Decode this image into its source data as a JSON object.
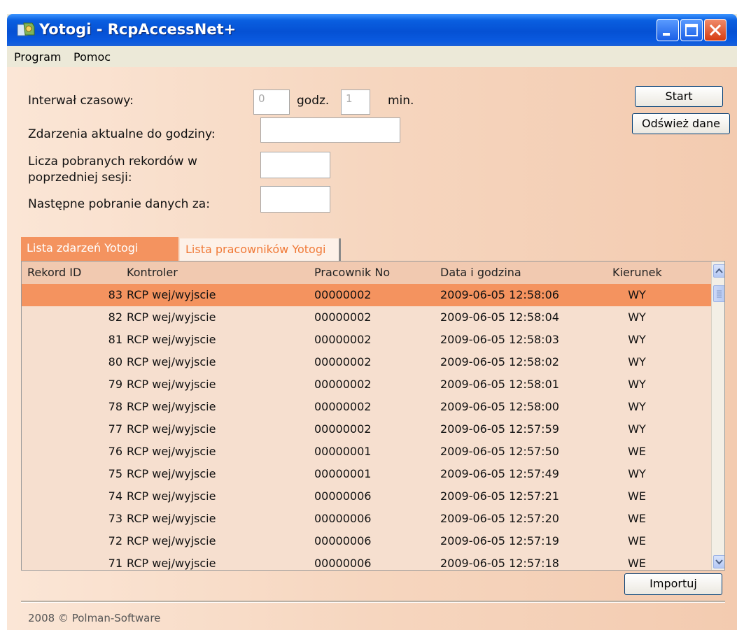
{
  "window": {
    "title": "Yotogi - RcpAccessNet+"
  },
  "menu": {
    "items": [
      {
        "label": "Program"
      },
      {
        "label": "Pomoc"
      }
    ]
  },
  "form": {
    "interval_label": "Interwał czasowy:",
    "interval_hours": "0",
    "hours_unit": "godz.",
    "interval_minutes": "1",
    "minutes_unit": "min.",
    "events_label": "Zdarzenia aktualne do godziny:",
    "records_label_line1": "Licza pobranych rekordów w",
    "records_label_line2": "poprzedniej sesji:",
    "next_label": "Następne pobranie danych za:"
  },
  "buttons": {
    "start": "Start",
    "refresh": "Odśwież dane",
    "import": "Importuj"
  },
  "tabs": [
    {
      "label": "Lista zdarzeń Yotogi",
      "active": true
    },
    {
      "label": "Lista pracowników Yotogi",
      "active": false
    }
  ],
  "table": {
    "columns": [
      "Rekord ID",
      "Kontroler",
      "Pracownik No",
      "Data i godzina",
      "Kierunek"
    ],
    "rows": [
      [
        "83",
        "RCP wej/wyjscie",
        "00000002",
        "2009-06-05 12:58:06",
        "WY"
      ],
      [
        "82",
        "RCP wej/wyjscie",
        "00000002",
        "2009-06-05 12:58:04",
        "WY"
      ],
      [
        "81",
        "RCP wej/wyjscie",
        "00000002",
        "2009-06-05 12:58:03",
        "WY"
      ],
      [
        "80",
        "RCP wej/wyjscie",
        "00000002",
        "2009-06-05 12:58:02",
        "WY"
      ],
      [
        "79",
        "RCP wej/wyjscie",
        "00000002",
        "2009-06-05 12:58:01",
        "WY"
      ],
      [
        "78",
        "RCP wej/wyjscie",
        "00000002",
        "2009-06-05 12:58:00",
        "WY"
      ],
      [
        "77",
        "RCP wej/wyjscie",
        "00000002",
        "2009-06-05 12:57:59",
        "WY"
      ],
      [
        "76",
        "RCP wej/wyjscie",
        "00000001",
        "2009-06-05 12:57:50",
        "WE"
      ],
      [
        "75",
        "RCP wej/wyjscie",
        "00000001",
        "2009-06-05 12:57:49",
        "WY"
      ],
      [
        "74",
        "RCP wej/wyjscie",
        "00000006",
        "2009-06-05 12:57:21",
        "WE"
      ],
      [
        "73",
        "RCP wej/wyjscie",
        "00000006",
        "2009-06-05 12:57:20",
        "WE"
      ],
      [
        "72",
        "RCP wej/wyjscie",
        "00000006",
        "2009-06-05 12:57:19",
        "WE"
      ],
      [
        "71",
        "RCP wej/wyjscie",
        "00000006",
        "2009-06-05 12:57:18",
        "WE"
      ]
    ],
    "selected_row": 0
  },
  "footer": {
    "text": "2008 © Polman-Software"
  },
  "colors": {
    "accent": "#f4935f",
    "titlebar": "#0551d4"
  }
}
